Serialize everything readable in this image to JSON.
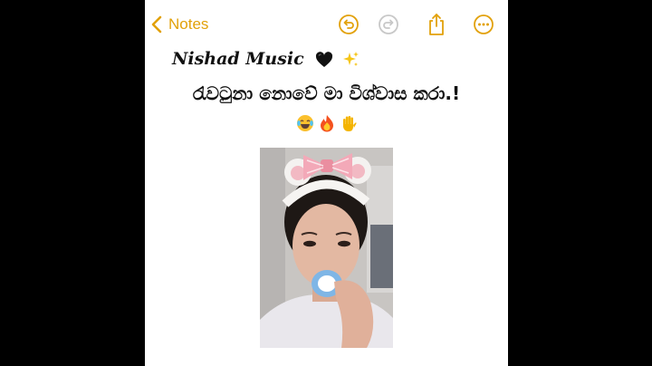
{
  "header": {
    "back_label": "Notes",
    "accent_color": "#E2A10A",
    "icons": [
      "undo-icon",
      "redo-icon",
      "share-icon",
      "more-icon"
    ]
  },
  "note": {
    "title": "Nishad Music",
    "title_icons": [
      "black-heart-emoji",
      "sparkles-emoji"
    ],
    "line2": "රැවටුනා නොවේ මා විශ්වාස කරා.!",
    "emoji_line": [
      "laughing-tears-emoji",
      "fire-emoji",
      "raised-hand-emoji"
    ],
    "photo_icon": "girl-with-bow-headband-photo"
  }
}
